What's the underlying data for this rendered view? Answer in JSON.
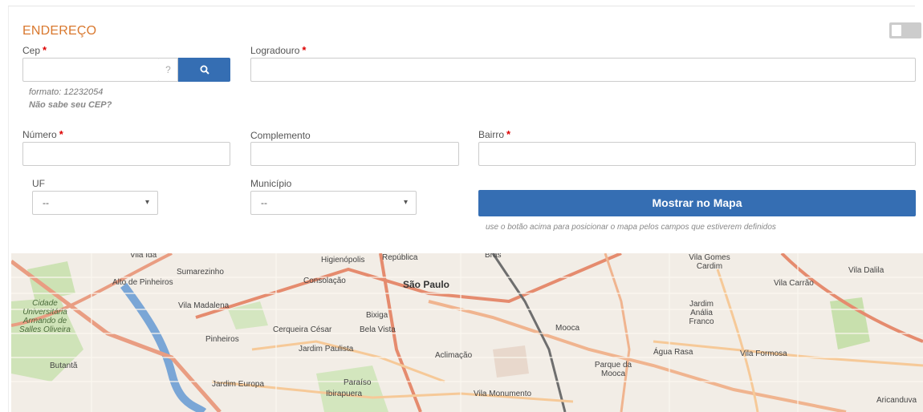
{
  "section": {
    "title": "ENDEREÇO"
  },
  "fields": {
    "cep": {
      "label": "Cep",
      "value": "",
      "help_button": "?",
      "format_hint": "formato: 12232054",
      "unknown_link": "Não sabe seu CEP?"
    },
    "logradouro": {
      "label": "Logradouro",
      "value": ""
    },
    "numero": {
      "label": "Número",
      "value": ""
    },
    "complemento": {
      "label": "Complemento",
      "value": ""
    },
    "bairro": {
      "label": "Bairro",
      "value": ""
    },
    "uf": {
      "label": "UF",
      "selected": "--"
    },
    "municipio": {
      "label": "Município",
      "selected": "--"
    }
  },
  "required_marker": "*",
  "map_button": {
    "label": "Mostrar no Mapa",
    "help": "use o botão acima para posicionar o mapa pelos campos que estiverem definidos"
  },
  "colors": {
    "accent": "#d9782e",
    "primary": "#356eb3",
    "required": "#dd0000"
  },
  "map": {
    "places": [
      "Vila Ida",
      "Sumarezinho",
      "Alto de Pinheiros",
      "Higienópolis",
      "República",
      "Brás",
      "Vila Gomes Cardim",
      "Vila Dalila",
      "Consolação",
      "São Paulo",
      "Vila Carrão",
      "Cidade Universitária Armando de Salles Oliveira",
      "Butantã",
      "Vila Madalena",
      "Bixiga",
      "Jardim Anália Franco",
      "Cerqueira César",
      "Bela Vista",
      "Mooca",
      "Pinheiros",
      "Jardim Paulista",
      "Aclimação",
      "Água Rasa",
      "Vila Formosa",
      "Parque da Mooca",
      "Jardim Europa",
      "Paraíso",
      "Ibirapuera",
      "Vila Monumento",
      "Aricanduva"
    ]
  }
}
